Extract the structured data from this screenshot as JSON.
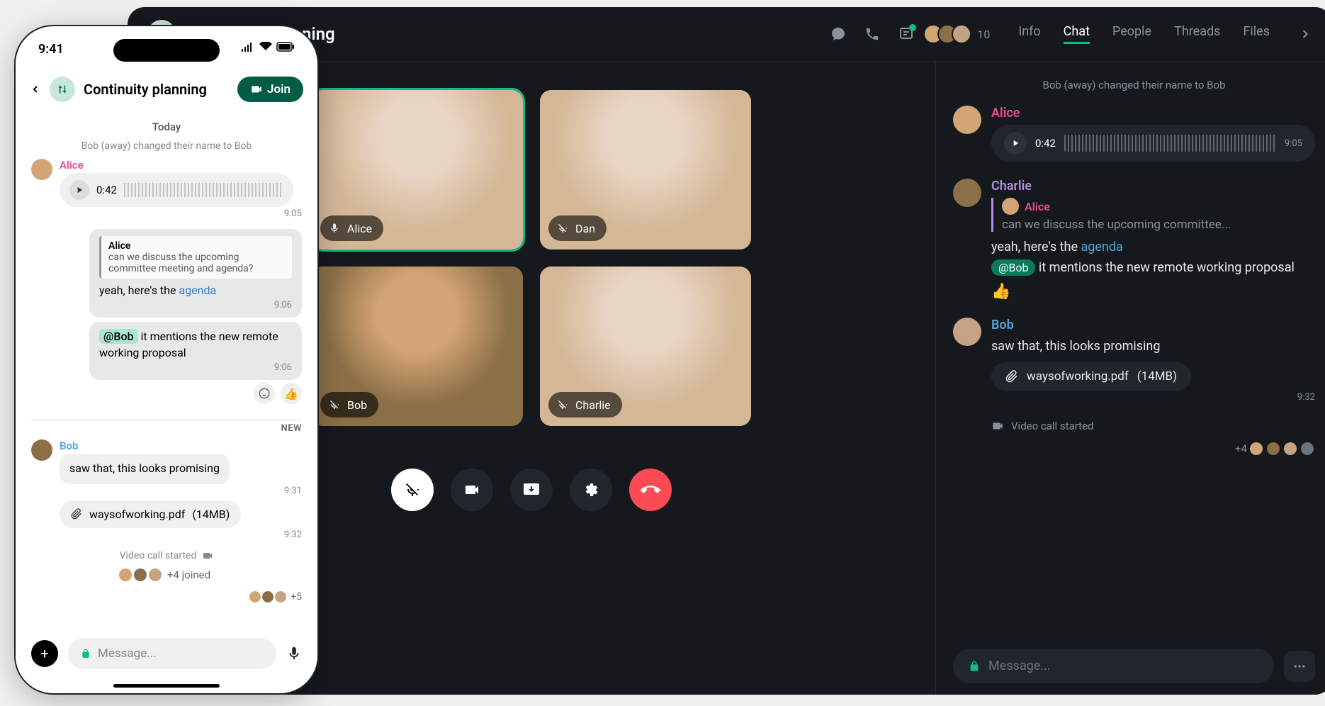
{
  "room": {
    "title": "Continuity planning",
    "member_count": "10"
  },
  "desktop": {
    "tabs": [
      "Info",
      "Chat",
      "People",
      "Threads",
      "Files"
    ],
    "active_tab": 1,
    "system_message": "Bob (away) changed their name to Bob",
    "messages": {
      "alice_voice": {
        "sender": "Alice",
        "duration": "0:42",
        "time": "9:05"
      },
      "charlie": {
        "sender": "Charlie",
        "quote_sender": "Alice",
        "quote_text": "can we discuss the upcoming committee...",
        "line1_pre": "yeah, here's the ",
        "line1_link": "agenda",
        "mention": "@Bob",
        "line2_post": " it mentions the new remote working proposal",
        "reaction": "👍"
      },
      "bob": {
        "sender": "Bob",
        "text": "saw that, this looks promising",
        "file_name": "waysofworking.pdf",
        "file_size": "(14MB)",
        "file_time": "9:32"
      }
    },
    "call_started": "Video call started",
    "joined_count": "+4",
    "composer_placeholder": "Message...",
    "video_tiles": [
      "Alice",
      "Dan",
      "Bob",
      "Charlie"
    ]
  },
  "mobile": {
    "time": "9:41",
    "join_label": "Join",
    "day_label": "Today",
    "system_message": "Bob (away) changed their name to Bob",
    "alice_voice": {
      "sender": "Alice",
      "duration": "0:42",
      "time": "9:05"
    },
    "reply": {
      "quote_sender": "Alice",
      "quote_text": "can we discuss the upcoming committee meeting and agenda?",
      "line1_pre": "yeah, here's the ",
      "line1_link": "agenda",
      "time1": "9:06",
      "mention": "@Bob",
      "line2_post": " it mentions the new remote working proposal",
      "time2": "9:06"
    },
    "reaction": "👍",
    "new_label": "NEW",
    "bob": {
      "sender": "Bob",
      "text": "saw that, this looks promising",
      "time1": "9:31",
      "file_name": "waysofworking.pdf",
      "file_size": "(14MB)",
      "time2": "9:32"
    },
    "call_started": "Video call started",
    "joined_label": "+4 joined",
    "joined_count2": "+5",
    "composer_placeholder": "Message..."
  }
}
